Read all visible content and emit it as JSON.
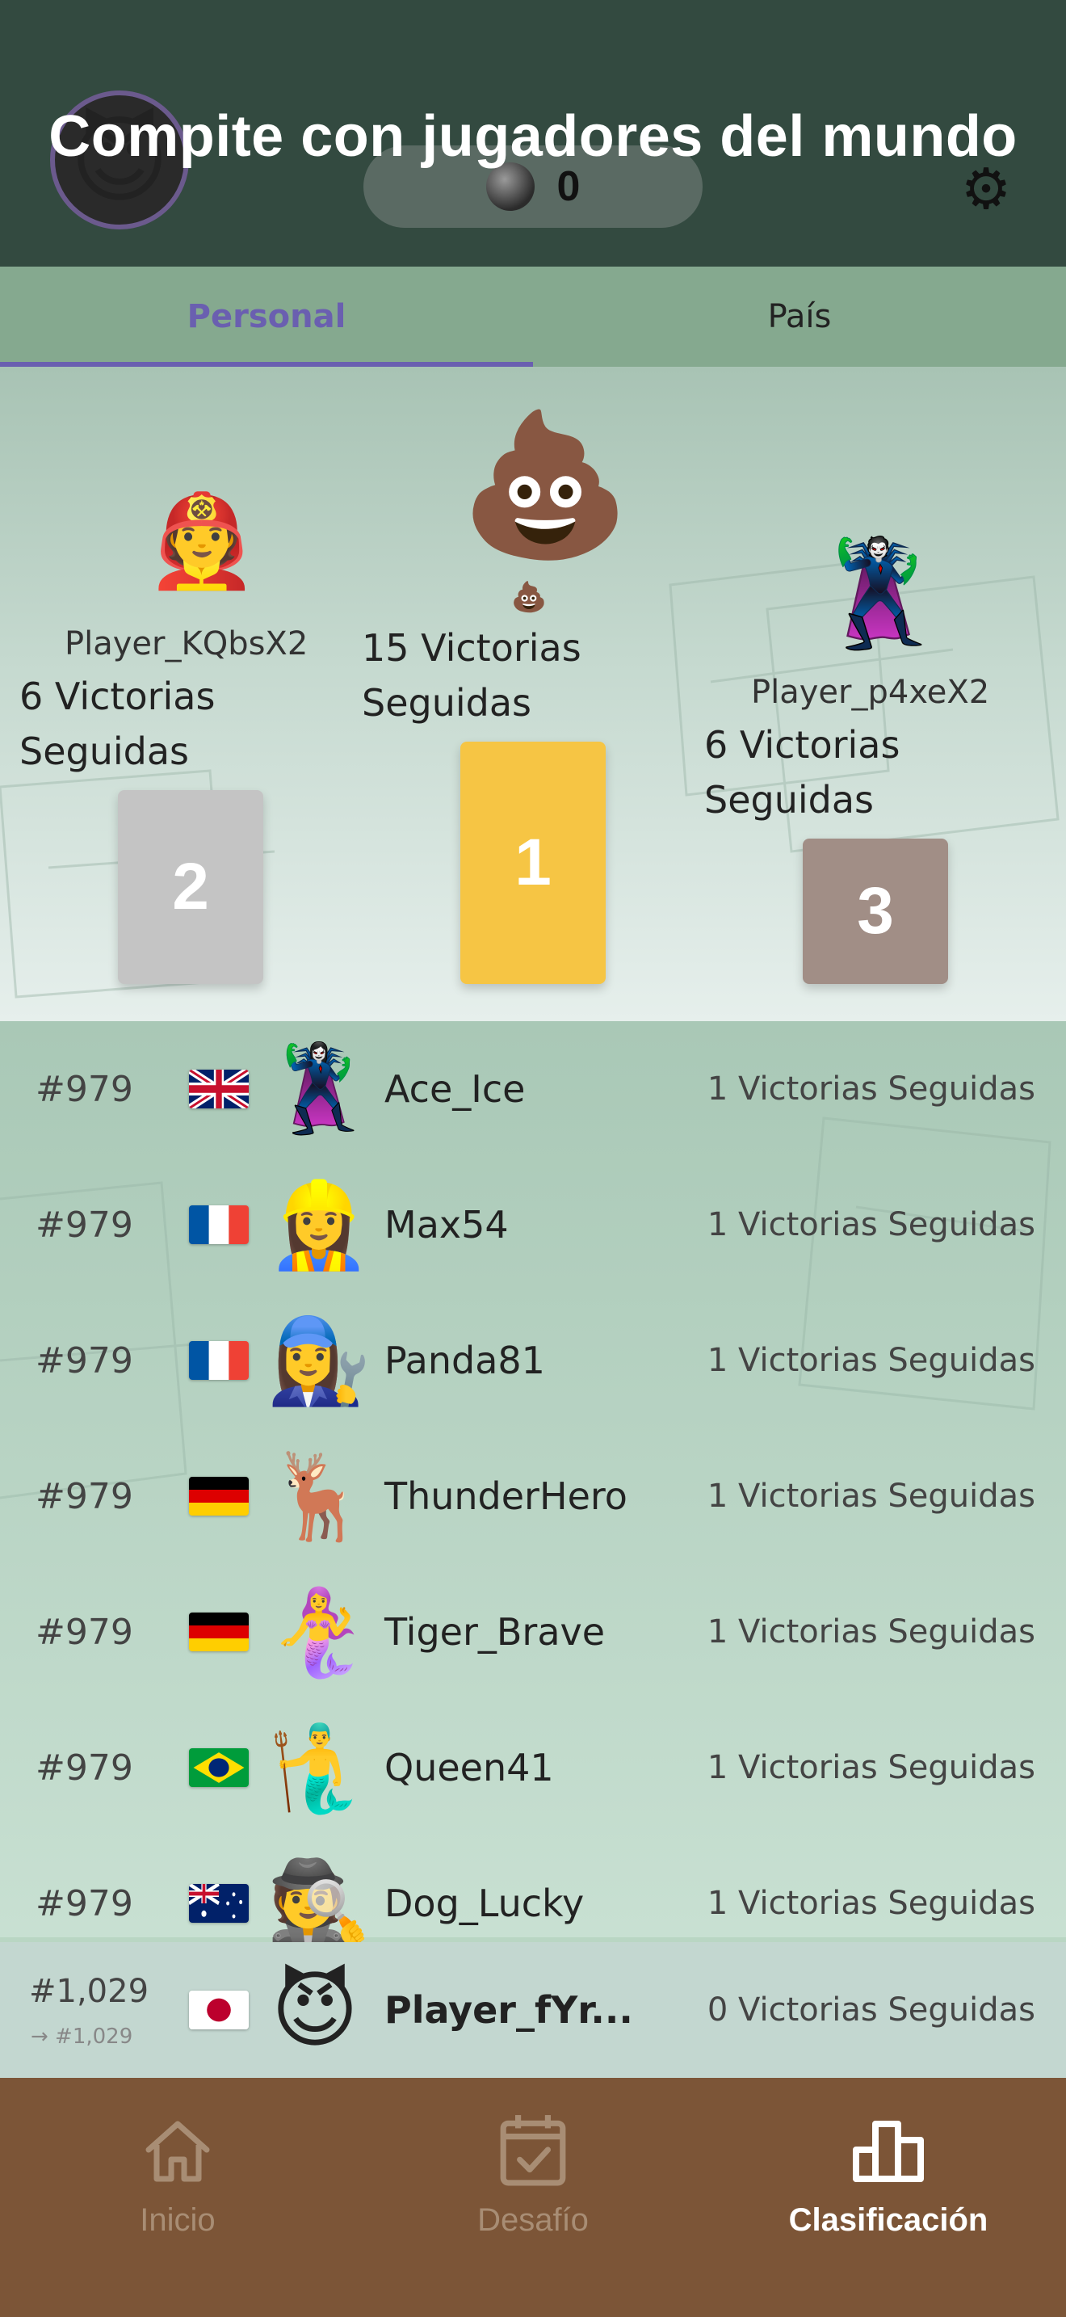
{
  "header": {
    "title": "Compite con jugadores del mundo",
    "coins": "0",
    "avatar_emoji": "😈",
    "icons": [
      "coin-icon",
      "gear-icon"
    ]
  },
  "tabs": [
    {
      "label": "Personal",
      "active": true
    },
    {
      "label": "País",
      "active": false
    }
  ],
  "podium": {
    "first": {
      "emoji": "💩",
      "small_emoji": "💩",
      "wins": "15 Victorias Seguidas",
      "place": "1",
      "color": "#f6c544"
    },
    "second": {
      "emoji": "🧑‍🚒",
      "name": "Player_KQbsX2",
      "wins": "6 Victorias Seguidas",
      "place": "2",
      "color": "#c4c4c4"
    },
    "third": {
      "emoji": "🦹",
      "name": "Player_p4xeX2",
      "wins": "6 Victorias Seguidas",
      "place": "3",
      "color": "#a18e86"
    }
  },
  "leaderboard": [
    {
      "rank": "#979",
      "flag": "gb",
      "avatar": "🦹‍♀️",
      "name": "Ace_Ice",
      "wins": "1 Victorias Seguidas"
    },
    {
      "rank": "#979",
      "flag": "fr",
      "avatar": "👷‍♀️",
      "name": "Max54",
      "wins": "1 Victorias Seguidas"
    },
    {
      "rank": "#979",
      "flag": "fr",
      "avatar": "👩‍🔧",
      "name": "Panda81",
      "wins": "1 Victorias Seguidas"
    },
    {
      "rank": "#979",
      "flag": "de",
      "avatar": "🦌",
      "name": "ThunderHero",
      "wins": "1 Victorias Seguidas"
    },
    {
      "rank": "#979",
      "flag": "de",
      "avatar": "🧜‍♀️",
      "name": "Tiger_Brave",
      "wins": "1 Victorias Seguidas"
    },
    {
      "rank": "#979",
      "flag": "br",
      "avatar": "🧜‍♂️",
      "name": "Queen41",
      "wins": "1 Victorias Seguidas"
    },
    {
      "rank": "#979",
      "flag": "au",
      "avatar": "🕵️",
      "name": "Dog_Lucky",
      "wins": "1 Victorias Seguidas"
    }
  ],
  "me": {
    "rank": "#1,029",
    "sub_rank": "→ #1,029",
    "flag": "jp",
    "avatar": "😈",
    "name": "Player_fYr...",
    "wins": "0 Victorias Seguidas"
  },
  "bottom_nav": [
    {
      "label": "Inicio",
      "icon": "home-icon",
      "active": false
    },
    {
      "label": "Desafío",
      "icon": "calendar-check-icon",
      "active": false
    },
    {
      "label": "Clasificación",
      "icon": "leaderboard-icon",
      "active": true
    }
  ]
}
